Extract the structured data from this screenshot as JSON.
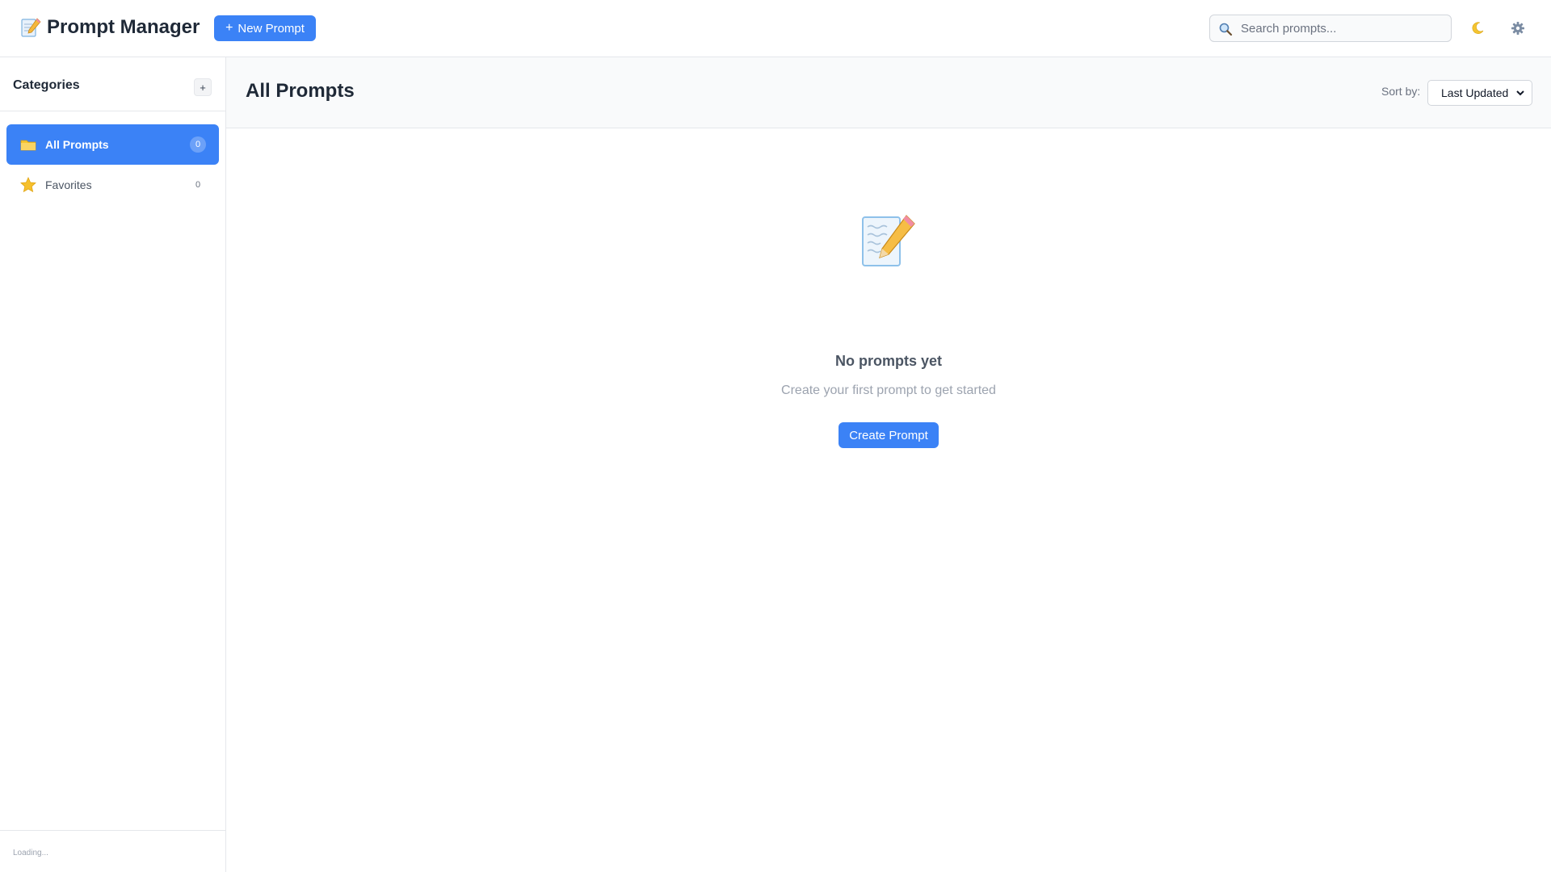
{
  "app": {
    "title": "Prompt Manager",
    "logo_icon": "memo-icon",
    "new_prompt_label": "New Prompt",
    "accent_color": "#3b82f6"
  },
  "search": {
    "placeholder": "Search prompts...",
    "value": ""
  },
  "toolbar": {
    "theme_icon": "moon-icon",
    "settings_icon": "gear-icon"
  },
  "sidebar": {
    "title": "Categories",
    "add_label": "+",
    "items": [
      {
        "label": "All Prompts",
        "count": "0",
        "icon": "folder-icon",
        "active": true
      },
      {
        "label": "Favorites",
        "count": "0",
        "icon": "star-icon",
        "active": false
      }
    ],
    "status": "Loading..."
  },
  "main": {
    "title": "All Prompts",
    "sort_label": "Sort by:",
    "sort_value": "Last Updated",
    "empty": {
      "icon": "memo-icon",
      "title": "No prompts yet",
      "subtitle": "Create your first prompt to get started",
      "button_label": "Create Prompt"
    }
  }
}
